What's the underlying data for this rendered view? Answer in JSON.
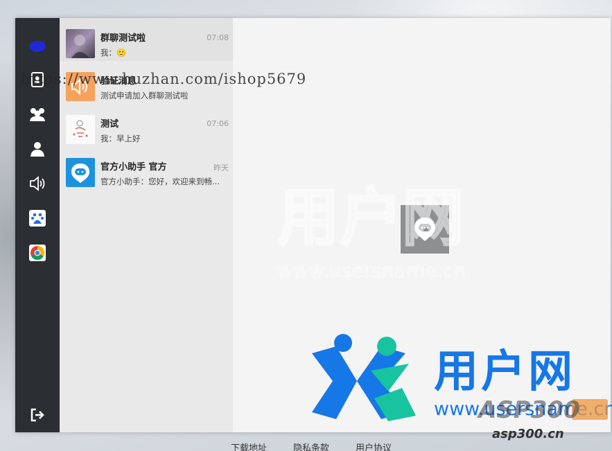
{
  "watermark": {
    "url_text": "https://www.huzhan.com/ishop5679",
    "brand_cn": "用户网",
    "brand_url": "www.usersname.cn",
    "site_tag": "ASP300",
    "site_url": "asp300.cn",
    "big_brand_cn": "用户网",
    "big_brand_url": "www.usersname.cn"
  },
  "sidebar": {
    "icons": [
      {
        "name": "user-avatar",
        "icon": "avatar"
      },
      {
        "name": "contacts-icon",
        "icon": "address-book"
      },
      {
        "name": "group-icon",
        "icon": "group"
      },
      {
        "name": "person-icon",
        "icon": "person"
      },
      {
        "name": "speaker-icon",
        "icon": "speaker"
      },
      {
        "name": "baidu-icon",
        "icon": "baidu"
      },
      {
        "name": "chrome-icon",
        "icon": "chrome"
      },
      {
        "name": "logout-icon",
        "icon": "logout"
      }
    ]
  },
  "conversations": [
    {
      "name": "群聊测试啦",
      "time": "07:08",
      "message": "我：🙂",
      "avatar": "group-photo"
    },
    {
      "name": "验证消息",
      "time": "",
      "message": "测试申请加入群聊测试啦",
      "avatar": "speaker"
    },
    {
      "name": "测试",
      "time": "07:06",
      "message": "我：早上好",
      "avatar": "doodle"
    },
    {
      "name": "官方小助手 官方",
      "time": "昨天",
      "message": "官方小助手：您好，欢迎来到畅...",
      "avatar": "assistant"
    }
  ],
  "footer": {
    "download": "下载地址",
    "privacy": "隐私条款",
    "agreement": "用户协议"
  },
  "colors": {
    "nav_bg": "#2b2e33",
    "list_bg": "#e9e9e9",
    "accent_blue": "#1677e6",
    "accent_green": "#18c3a0",
    "verify_orange": "#f5a25d"
  }
}
